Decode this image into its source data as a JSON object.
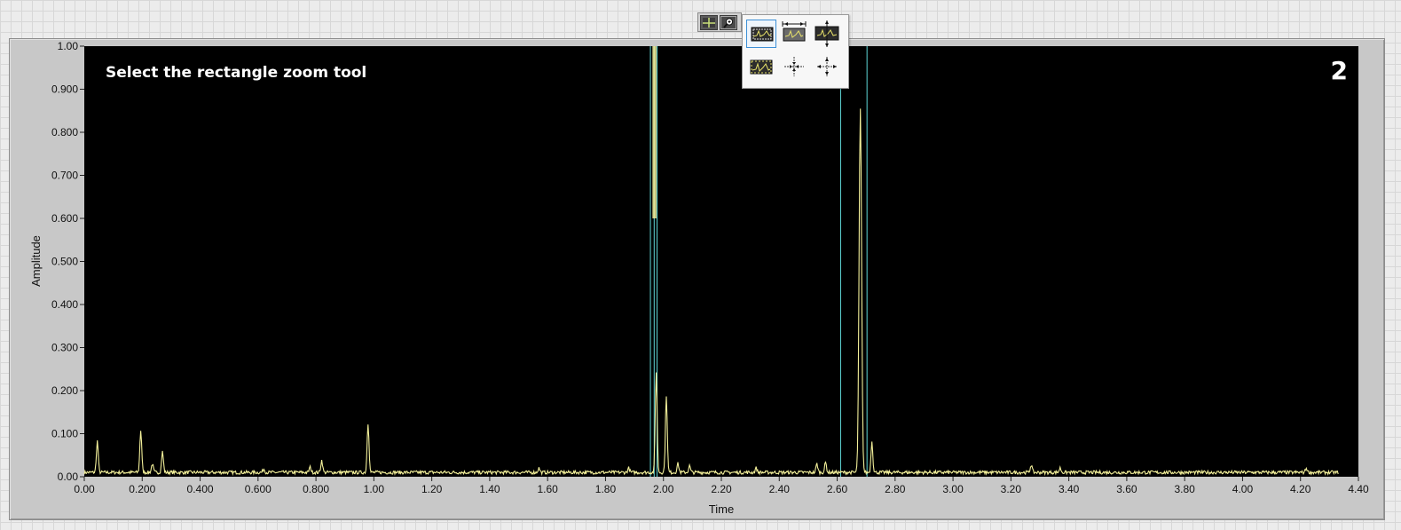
{
  "graph": {
    "overlay_instruction": "Select the rectangle zoom tool",
    "step_number": "2",
    "x_axis_label": "Time",
    "y_axis_label": "Amplitude"
  },
  "toolbar": {
    "buttons": [
      {
        "name": "cursor-move-tool-button",
        "icon": "crosshair-icon",
        "state": "active"
      },
      {
        "name": "zoom-tool-button",
        "icon": "magnifier-icon",
        "state": "pressed"
      }
    ]
  },
  "zoom_palette": {
    "options": [
      {
        "name": "rectangle-zoom",
        "icon": "rectangle-zoom-icon",
        "selected": true
      },
      {
        "name": "x-zoom",
        "icon": "x-zoom-icon",
        "selected": false
      },
      {
        "name": "y-zoom",
        "icon": "y-zoom-icon",
        "selected": false
      },
      {
        "name": "zoom-to-fit",
        "icon": "zoom-to-fit-icon",
        "selected": false
      },
      {
        "name": "zoom-in-about-point",
        "icon": "zoom-in-point-icon",
        "selected": false
      },
      {
        "name": "zoom-out-about-point",
        "icon": "zoom-out-point-icon",
        "selected": false
      }
    ]
  },
  "colors": {
    "plot_background": "#000000",
    "trace": "#f3f09a",
    "cursor_lines": "#5fd6d6",
    "overlay_text": "#ffffff",
    "frame": "#c8c8c8",
    "selection_border": "#3c8fd6"
  },
  "chart_data": {
    "type": "line",
    "xlabel": "Time",
    "ylabel": "Amplitude",
    "xlim": [
      0,
      4.4
    ],
    "ylim": [
      0,
      1.0
    ],
    "x_ticks": [
      "0.00",
      "0.200",
      "0.400",
      "0.600",
      "0.800",
      "1.00",
      "1.20",
      "1.40",
      "1.60",
      "1.80",
      "2.00",
      "2.20",
      "2.40",
      "2.60",
      "2.80",
      "3.00",
      "3.20",
      "3.40",
      "3.60",
      "3.80",
      "4.00",
      "4.20",
      "4.40"
    ],
    "y_ticks": [
      "0.00",
      "0.100",
      "0.200",
      "0.300",
      "0.400",
      "0.500",
      "0.600",
      "0.700",
      "0.800",
      "0.900",
      "1.00"
    ],
    "grid": false,
    "baseline": 0.01,
    "x_end": 4.33,
    "peaks": [
      {
        "x": 0.045,
        "y": 0.083
      },
      {
        "x": 0.195,
        "y": 0.108
      },
      {
        "x": 0.235,
        "y": 0.03
      },
      {
        "x": 0.27,
        "y": 0.058
      },
      {
        "x": 0.62,
        "y": 0.018
      },
      {
        "x": 0.78,
        "y": 0.022
      },
      {
        "x": 0.82,
        "y": 0.038
      },
      {
        "x": 0.98,
        "y": 0.125
      },
      {
        "x": 1.57,
        "y": 0.02
      },
      {
        "x": 1.88,
        "y": 0.02
      },
      {
        "x": 1.975,
        "y": 0.245
      },
      {
        "x": 2.01,
        "y": 0.19
      },
      {
        "x": 2.05,
        "y": 0.03
      },
      {
        "x": 2.09,
        "y": 0.025
      },
      {
        "x": 2.32,
        "y": 0.02
      },
      {
        "x": 2.53,
        "y": 0.03
      },
      {
        "x": 2.56,
        "y": 0.033
      },
      {
        "x": 2.68,
        "y": 0.853
      },
      {
        "x": 2.72,
        "y": 0.082
      },
      {
        "x": 3.27,
        "y": 0.028
      },
      {
        "x": 3.37,
        "y": 0.02
      },
      {
        "x": 4.22,
        "y": 0.02
      }
    ],
    "cursor_x": [
      1.955,
      1.968,
      1.978,
      2.612,
      2.703
    ],
    "cursor_band": {
      "x0": 1.962,
      "x1": 1.976,
      "y0": 0.6,
      "y1": 1.0
    }
  }
}
